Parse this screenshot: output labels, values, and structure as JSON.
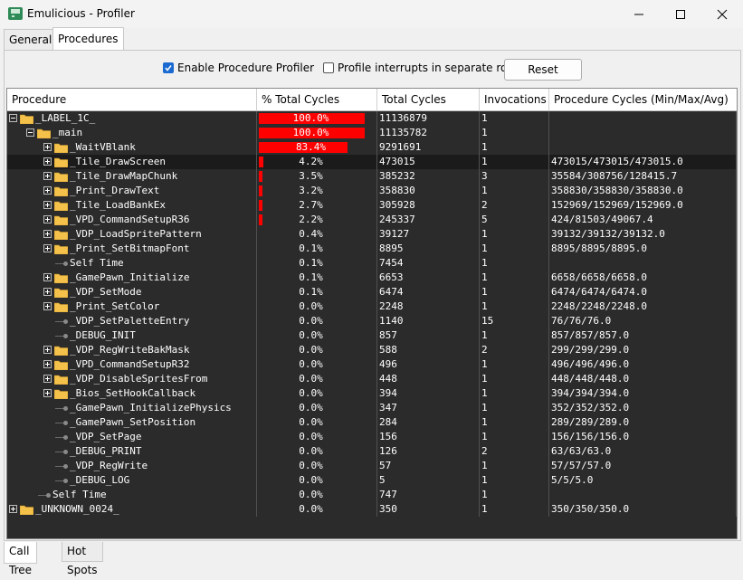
{
  "window": {
    "title": "Emulicious - Profiler"
  },
  "tabs": [
    {
      "label": "General"
    },
    {
      "label": "Procedures"
    }
  ],
  "options": {
    "enable_label": "Enable Procedure Profiler",
    "interrupts_label": "Profile interrupts in separate roots",
    "reset_label": "Reset",
    "enable_checked": true,
    "interrupts_checked": false
  },
  "columns": [
    "Procedure",
    "% Total Cycles",
    "Total Cycles",
    "Invocations",
    "Procedure Cycles (Min/Max/Avg)"
  ],
  "rows": [
    {
      "depth": 0,
      "kind": "collapse",
      "name": "_LABEL_1C_",
      "percent": "100.0%",
      "bar": 1.0,
      "total": "11136879",
      "invocations": "1",
      "minmaxavg": ""
    },
    {
      "depth": 1,
      "kind": "collapse",
      "name": "_main",
      "percent": "100.0%",
      "bar": 1.0,
      "total": "11135782",
      "invocations": "1",
      "minmaxavg": ""
    },
    {
      "depth": 2,
      "kind": "expand",
      "name": "_WaitVBlank",
      "percent": "83.4%",
      "bar": 0.834,
      "total": "9291691",
      "invocations": "1",
      "minmaxavg": ""
    },
    {
      "depth": 2,
      "kind": "expand",
      "name": "_Tile_DrawScreen",
      "percent": "4.2%",
      "bar": 0.042,
      "total": "473015",
      "invocations": "1",
      "minmaxavg": "473015/473015/473015.0",
      "sel": true
    },
    {
      "depth": 2,
      "kind": "expand",
      "name": "_Tile_DrawMapChunk",
      "percent": "3.5%",
      "bar": 0.035,
      "total": "385232",
      "invocations": "3",
      "minmaxavg": "35584/308756/128415.7"
    },
    {
      "depth": 2,
      "kind": "expand",
      "name": "_Print_DrawText",
      "percent": "3.2%",
      "bar": 0.032,
      "total": "358830",
      "invocations": "1",
      "minmaxavg": "358830/358830/358830.0"
    },
    {
      "depth": 2,
      "kind": "expand",
      "name": "_Tile_LoadBankEx",
      "percent": "2.7%",
      "bar": 0.027,
      "total": "305928",
      "invocations": "2",
      "minmaxavg": "152969/152969/152969.0"
    },
    {
      "depth": 2,
      "kind": "expand",
      "name": "_VPD_CommandSetupR36",
      "percent": "2.2%",
      "bar": 0.022,
      "total": "245337",
      "invocations": "5",
      "minmaxavg": "424/81503/49067.4"
    },
    {
      "depth": 2,
      "kind": "expand",
      "name": "_VDP_LoadSpritePattern",
      "percent": "0.4%",
      "bar": 0,
      "total": "39127",
      "invocations": "1",
      "minmaxavg": "39132/39132/39132.0"
    },
    {
      "depth": 2,
      "kind": "expand",
      "name": "_Print_SetBitmapFont",
      "percent": "0.1%",
      "bar": 0,
      "total": "8895",
      "invocations": "1",
      "minmaxavg": "8895/8895/8895.0"
    },
    {
      "depth": 2,
      "kind": "leaf",
      "name": "Self Time",
      "percent": "0.1%",
      "bar": 0,
      "total": "7454",
      "invocations": "1",
      "minmaxavg": ""
    },
    {
      "depth": 2,
      "kind": "expand",
      "name": "_GamePawn_Initialize",
      "percent": "0.1%",
      "bar": 0,
      "total": "6653",
      "invocations": "1",
      "minmaxavg": "6658/6658/6658.0"
    },
    {
      "depth": 2,
      "kind": "expand",
      "name": "_VDP_SetMode",
      "percent": "0.1%",
      "bar": 0,
      "total": "6474",
      "invocations": "1",
      "minmaxavg": "6474/6474/6474.0"
    },
    {
      "depth": 2,
      "kind": "expand",
      "name": "_Print_SetColor",
      "percent": "0.0%",
      "bar": 0,
      "total": "2248",
      "invocations": "1",
      "minmaxavg": "2248/2248/2248.0"
    },
    {
      "depth": 2,
      "kind": "leaf",
      "name": "_VDP_SetPaletteEntry",
      "percent": "0.0%",
      "bar": 0,
      "total": "1140",
      "invocations": "15",
      "minmaxavg": "76/76/76.0"
    },
    {
      "depth": 2,
      "kind": "leaf",
      "name": "_DEBUG_INIT",
      "percent": "0.0%",
      "bar": 0,
      "total": "857",
      "invocations": "1",
      "minmaxavg": "857/857/857.0"
    },
    {
      "depth": 2,
      "kind": "expand",
      "name": "_VDP_RegWriteBakMask",
      "percent": "0.0%",
      "bar": 0,
      "total": "588",
      "invocations": "2",
      "minmaxavg": "299/299/299.0"
    },
    {
      "depth": 2,
      "kind": "expand",
      "name": "_VPD_CommandSetupR32",
      "percent": "0.0%",
      "bar": 0,
      "total": "496",
      "invocations": "1",
      "minmaxavg": "496/496/496.0"
    },
    {
      "depth": 2,
      "kind": "expand",
      "name": "_VDP_DisableSpritesFrom",
      "percent": "0.0%",
      "bar": 0,
      "total": "448",
      "invocations": "1",
      "minmaxavg": "448/448/448.0"
    },
    {
      "depth": 2,
      "kind": "expand",
      "name": "_Bios_SetHookCallback",
      "percent": "0.0%",
      "bar": 0,
      "total": "394",
      "invocations": "1",
      "minmaxavg": "394/394/394.0"
    },
    {
      "depth": 2,
      "kind": "leaf",
      "name": "_GamePawn_InitializePhysics",
      "percent": "0.0%",
      "bar": 0,
      "total": "347",
      "invocations": "1",
      "minmaxavg": "352/352/352.0"
    },
    {
      "depth": 2,
      "kind": "leaf",
      "name": "_GamePawn_SetPosition",
      "percent": "0.0%",
      "bar": 0,
      "total": "284",
      "invocations": "1",
      "minmaxavg": "289/289/289.0"
    },
    {
      "depth": 2,
      "kind": "leaf",
      "name": "_VDP_SetPage",
      "percent": "0.0%",
      "bar": 0,
      "total": "156",
      "invocations": "1",
      "minmaxavg": "156/156/156.0"
    },
    {
      "depth": 2,
      "kind": "leaf",
      "name": "_DEBUG_PRINT",
      "percent": "0.0%",
      "bar": 0,
      "total": "126",
      "invocations": "2",
      "minmaxavg": "63/63/63.0"
    },
    {
      "depth": 2,
      "kind": "leaf",
      "name": "_VDP_RegWrite",
      "percent": "0.0%",
      "bar": 0,
      "total": "57",
      "invocations": "1",
      "minmaxavg": "57/57/57.0"
    },
    {
      "depth": 2,
      "kind": "leaf",
      "name": "_DEBUG_LOG",
      "percent": "0.0%",
      "bar": 0,
      "total": "5",
      "invocations": "1",
      "minmaxavg": "5/5/5.0"
    },
    {
      "depth": 1,
      "kind": "leaf",
      "name": "Self Time",
      "percent": "0.0%",
      "bar": 0,
      "total": "747",
      "invocations": "1",
      "minmaxavg": ""
    },
    {
      "depth": 0,
      "kind": "expand",
      "name": "_UNKNOWN_0024_",
      "percent": "0.0%",
      "bar": 0,
      "total": "350",
      "invocations": "1",
      "minmaxavg": "350/350/350.0"
    }
  ],
  "bottom_tabs": [
    {
      "label": "Call Tree"
    },
    {
      "label": "Hot Spots"
    }
  ]
}
